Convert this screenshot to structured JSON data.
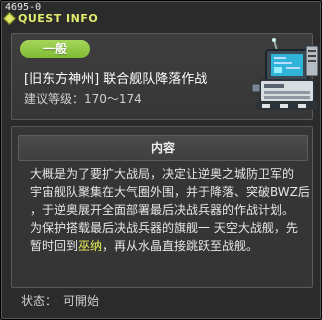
{
  "window": {
    "quest_id": "4695-0",
    "title": "QUEST INFO"
  },
  "header": {
    "badge": "一般",
    "quest_name": "[旧东方神州] 联合舰队降落作战",
    "level_label": "建议等级：170～174"
  },
  "content": {
    "heading": "内容",
    "line1": "大概是为了要扩大战局，决定让逆奥之城防卫军的",
    "line2": "宇宙舰队聚集在大气圈外围，并于降落、突破BWZ后",
    "line3": "，于逆奥展开全面部署最后决战兵器的作战计划。",
    "line4": "为保护搭载最后决战兵器的旗舰一 天空大战舰，先",
    "line5_a": "暂时回到",
    "line5_highlight": "巫纳",
    "line5_b": "，再从水晶直接跳跃至战舰。"
  },
  "status": {
    "label": "状态：",
    "value": "可開始"
  },
  "colors": {
    "title": "#e4ec6e",
    "badge": "#8cc63f",
    "highlight": "#e8f05a"
  }
}
